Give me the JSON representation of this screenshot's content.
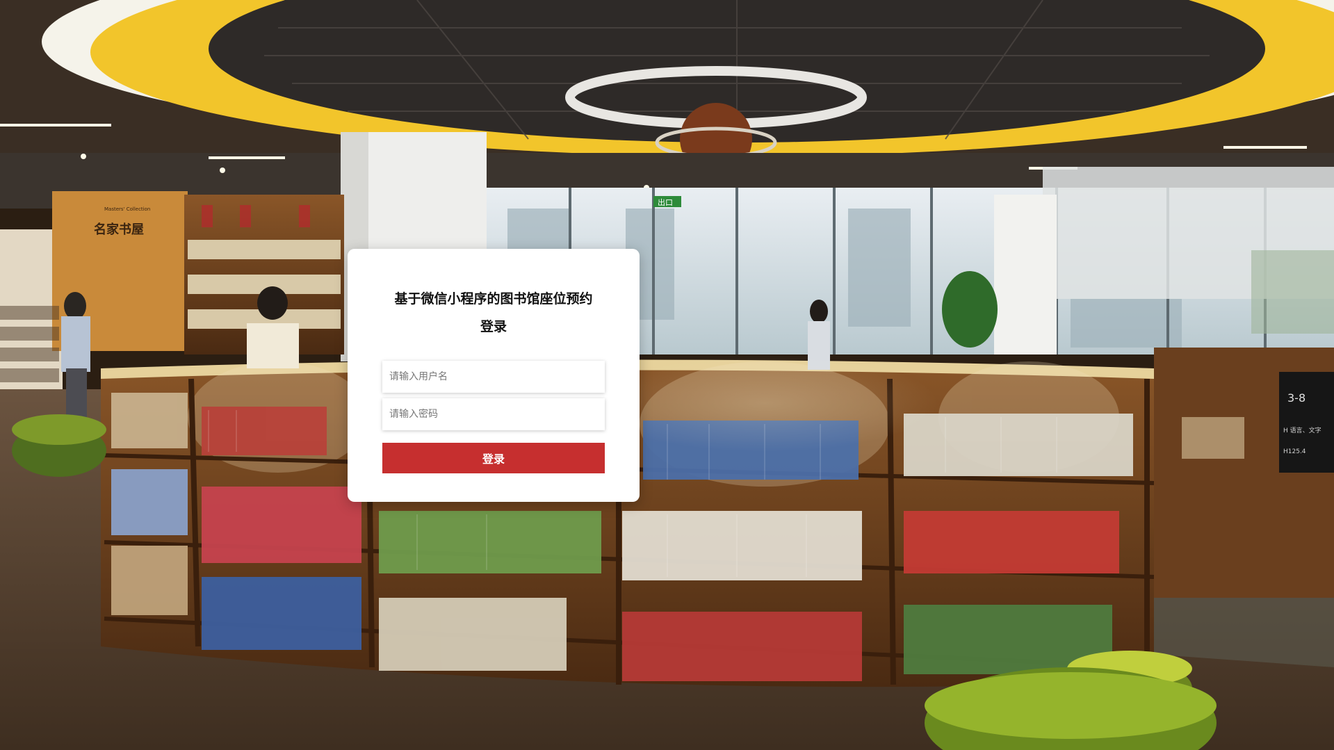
{
  "page": {
    "title": "基于微信小程序的图书馆座位预约登录"
  },
  "background": {
    "scene": "library-interior-photo",
    "sign_collection": "Masters' Collection",
    "sign_title": "名家书屋",
    "exit_sign": "出口",
    "shelf_code": "3-8",
    "shelf_category": "H 语言、文字",
    "shelf_call_no": "H125.4"
  },
  "login": {
    "username": {
      "value": "",
      "placeholder": "请输入用户名"
    },
    "password": {
      "value": "",
      "placeholder": "请输入密码"
    },
    "submit_label": "登录"
  },
  "colors": {
    "accent": "#c62f2f",
    "card": "#ffffff",
    "ceiling_ring": "#f2c52b",
    "stool": "#8fae2a",
    "wood": "#7a4a22"
  }
}
